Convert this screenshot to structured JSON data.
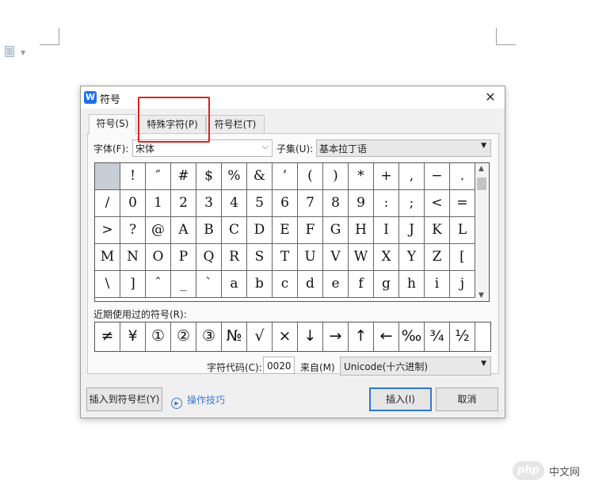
{
  "dialog": {
    "title": "符号",
    "close_glyph": "✕",
    "app_icon_letter": "W",
    "tabs": [
      {
        "label": "符号(S)",
        "active": true
      },
      {
        "label": "特殊字符(P)",
        "active": false
      },
      {
        "label": "符号栏(T)",
        "active": false
      }
    ],
    "font_label": "字体(F):",
    "font_value": "宋体",
    "subset_label": "子集(U):",
    "subset_value": "基本拉丁语",
    "symbols": [
      "",
      "!",
      "″",
      "#",
      "$",
      "%",
      "&",
      "’",
      "(",
      ")",
      "*",
      "+",
      ",",
      "−",
      ".",
      "/",
      "0",
      "1",
      "2",
      "3",
      "4",
      "5",
      "6",
      "7",
      "8",
      "9",
      ":",
      ";",
      "<",
      "=",
      ">",
      "?",
      "@",
      "A",
      "B",
      "C",
      "D",
      "E",
      "F",
      "G",
      "H",
      "I",
      "J",
      "K",
      "L",
      "M",
      "N",
      "O",
      "P",
      "Q",
      "R",
      "S",
      "T",
      "U",
      "V",
      "W",
      "X",
      "Y",
      "Z",
      "[",
      "\\",
      "]",
      "ˆ",
      "_",
      "`",
      "a",
      "b",
      "c",
      "d",
      "e",
      "f",
      "g",
      "h",
      "i",
      "j"
    ],
    "recent_label": "近期使用过的符号(R):",
    "recent_symbols": [
      "≠",
      "¥",
      "①",
      "②",
      "③",
      "№",
      "√",
      "×",
      "↓",
      "→",
      "↑",
      "←",
      "‰",
      "¾",
      "½"
    ],
    "code_label": "字符代码(C):",
    "code_value": "0020",
    "from_label": "来自(M)",
    "from_value": "Unicode(十六进制)",
    "insert_to_bar_button": "插入到符号栏(Y)",
    "tips_link": "操作技巧",
    "insert_button": "插入(I)",
    "cancel_button": "取消"
  },
  "watermark": {
    "logo": "php",
    "text": "中文网"
  },
  "colors": {
    "highlight_box": "#e02020",
    "accent": "#2d78d8",
    "link": "#3a7bd5"
  }
}
